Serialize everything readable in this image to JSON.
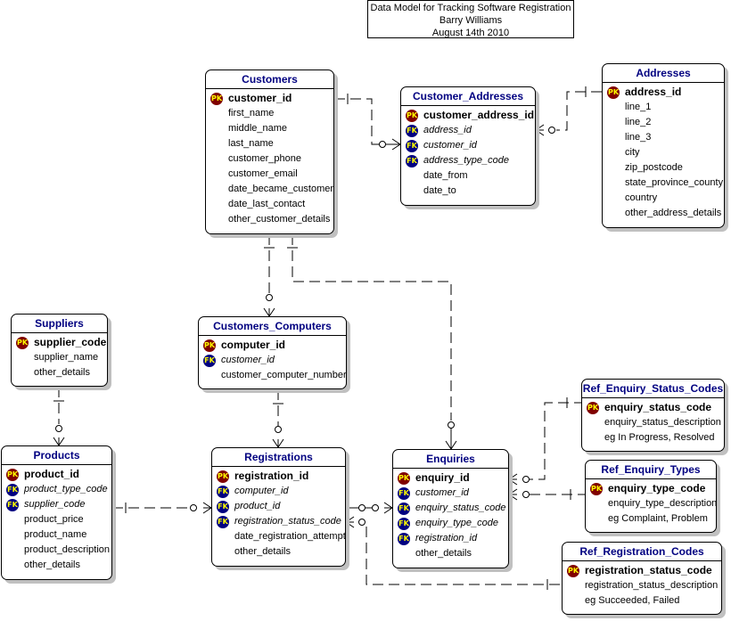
{
  "title": {
    "line1": "Data Model for Tracking Software Registration",
    "line2": "Barry Williams",
    "line3": "August 14th 2010"
  },
  "key_labels": {
    "pk": "PK",
    "fk": "FK"
  },
  "entities": {
    "customers": {
      "name": "Customers",
      "attributes": [
        {
          "name": "customer_id",
          "key": "pk"
        },
        {
          "name": "first_name",
          "key": ""
        },
        {
          "name": "middle_name",
          "key": ""
        },
        {
          "name": "last_name",
          "key": ""
        },
        {
          "name": "customer_phone",
          "key": ""
        },
        {
          "name": "customer_email",
          "key": ""
        },
        {
          "name": "date_became_customer",
          "key": ""
        },
        {
          "name": "date_last_contact",
          "key": ""
        },
        {
          "name": "other_customer_details",
          "key": ""
        }
      ]
    },
    "customer_addresses": {
      "name": "Customer_Addresses",
      "attributes": [
        {
          "name": "customer_address_id",
          "key": "pk"
        },
        {
          "name": "address_id",
          "key": "fk"
        },
        {
          "name": "customer_id",
          "key": "fk"
        },
        {
          "name": "address_type_code",
          "key": "fk"
        },
        {
          "name": "date_from",
          "key": ""
        },
        {
          "name": "date_to",
          "key": ""
        }
      ]
    },
    "addresses": {
      "name": "Addresses",
      "attributes": [
        {
          "name": "address_id",
          "key": "pk"
        },
        {
          "name": "line_1",
          "key": ""
        },
        {
          "name": "line_2",
          "key": ""
        },
        {
          "name": "line_3",
          "key": ""
        },
        {
          "name": "city",
          "key": ""
        },
        {
          "name": "zip_postcode",
          "key": ""
        },
        {
          "name": "state_province_county",
          "key": ""
        },
        {
          "name": "country",
          "key": ""
        },
        {
          "name": "other_address_details",
          "key": ""
        }
      ]
    },
    "suppliers": {
      "name": "Suppliers",
      "attributes": [
        {
          "name": "supplier_code",
          "key": "pk"
        },
        {
          "name": "supplier_name",
          "key": ""
        },
        {
          "name": "other_details",
          "key": ""
        }
      ]
    },
    "customers_computers": {
      "name": "Customers_Computers",
      "attributes": [
        {
          "name": "computer_id",
          "key": "pk"
        },
        {
          "name": "customer_id",
          "key": "fk"
        },
        {
          "name": "customer_computer_number",
          "key": ""
        }
      ]
    },
    "products": {
      "name": "Products",
      "attributes": [
        {
          "name": "product_id",
          "key": "pk"
        },
        {
          "name": "product_type_code",
          "key": "fk"
        },
        {
          "name": "supplier_code",
          "key": "fk"
        },
        {
          "name": "product_price",
          "key": ""
        },
        {
          "name": "product_name",
          "key": ""
        },
        {
          "name": "product_description",
          "key": ""
        },
        {
          "name": "other_details",
          "key": ""
        }
      ]
    },
    "registrations": {
      "name": "Registrations",
      "attributes": [
        {
          "name": "registration_id",
          "key": "pk"
        },
        {
          "name": "computer_id",
          "key": "fk"
        },
        {
          "name": "product_id",
          "key": "fk"
        },
        {
          "name": "registration_status_code",
          "key": "fk"
        },
        {
          "name": "date_registration_attempt",
          "key": ""
        },
        {
          "name": "other_details",
          "key": ""
        }
      ]
    },
    "enquiries": {
      "name": "Enquiries",
      "attributes": [
        {
          "name": "enquiry_id",
          "key": "pk"
        },
        {
          "name": "customer_id",
          "key": "fk"
        },
        {
          "name": "enquiry_status_code",
          "key": "fk"
        },
        {
          "name": "enquiry_type_code",
          "key": "fk"
        },
        {
          "name": "registration_id",
          "key": "fk"
        },
        {
          "name": "other_details",
          "key": ""
        }
      ]
    },
    "ref_enquiry_status_codes": {
      "name": "Ref_Enquiry_Status_Codes",
      "attributes": [
        {
          "name": "enquiry_status_code",
          "key": "pk"
        },
        {
          "name": "enquiry_status_description",
          "key": ""
        },
        {
          "name": "eg In Progress, Resolved",
          "key": ""
        }
      ]
    },
    "ref_enquiry_types": {
      "name": "Ref_Enquiry_Types",
      "attributes": [
        {
          "name": "enquiry_type_code",
          "key": "pk"
        },
        {
          "name": "enquiry_type_description",
          "key": ""
        },
        {
          "name": "eg Complaint, Problem",
          "key": ""
        }
      ]
    },
    "ref_registration_codes": {
      "name": "Ref_Registration_Codes",
      "attributes": [
        {
          "name": "registration_status_code",
          "key": "pk"
        },
        {
          "name": "registration_status_description",
          "key": ""
        },
        {
          "name": "eg Succeeded, Failed",
          "key": ""
        }
      ]
    }
  },
  "relationships": [
    {
      "from": "customers",
      "to": "customer_addresses",
      "type": "one-to-many"
    },
    {
      "from": "addresses",
      "to": "customer_addresses",
      "type": "one-to-many"
    },
    {
      "from": "customers",
      "to": "customers_computers",
      "type": "one-to-many"
    },
    {
      "from": "customers",
      "to": "enquiries",
      "type": "one-to-many"
    },
    {
      "from": "suppliers",
      "to": "products",
      "type": "one-to-many"
    },
    {
      "from": "customers_computers",
      "to": "registrations",
      "type": "one-to-many"
    },
    {
      "from": "products",
      "to": "registrations",
      "type": "one-to-many"
    },
    {
      "from": "registrations",
      "to": "enquiries",
      "type": "one-to-many"
    },
    {
      "from": "ref_enquiry_status_codes",
      "to": "enquiries",
      "type": "one-to-many"
    },
    {
      "from": "ref_enquiry_types",
      "to": "enquiries",
      "type": "one-to-many"
    },
    {
      "from": "ref_registration_codes",
      "to": "registrations",
      "type": "one-to-many"
    }
  ]
}
